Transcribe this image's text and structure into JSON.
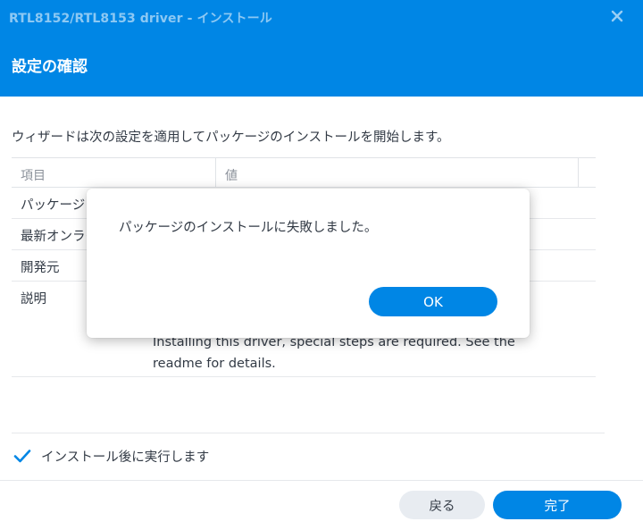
{
  "window": {
    "title": "RTL8152/RTL8153 driver - インストール",
    "subtitle": "設定の確認"
  },
  "intro": "ウィザードは次の設定を適用してパッケージのインストールを開始します。",
  "table": {
    "headers": [
      "項目",
      "値"
    ],
    "rows": [
      {
        "key": "パッケージ",
        "value": ""
      },
      {
        "key": "最新オンライ",
        "value": ""
      },
      {
        "key": "開発元",
        "value": ""
      },
      {
        "key": "説明",
        "value": "ers\n\nInstalling this driver, special steps are required. See the\nreadme for details."
      }
    ]
  },
  "checkbox": {
    "label": "インストール後に実行します",
    "checked": true
  },
  "buttons": {
    "back": "戻る",
    "done": "完了"
  },
  "modal": {
    "message": "パッケージのインストールに失敗しました。",
    "ok": "OK"
  },
  "colors": {
    "accent": "#0086e5",
    "text": "#323a45"
  },
  "icons": {
    "close": "close-icon",
    "checkbox": "checkmark-icon"
  }
}
